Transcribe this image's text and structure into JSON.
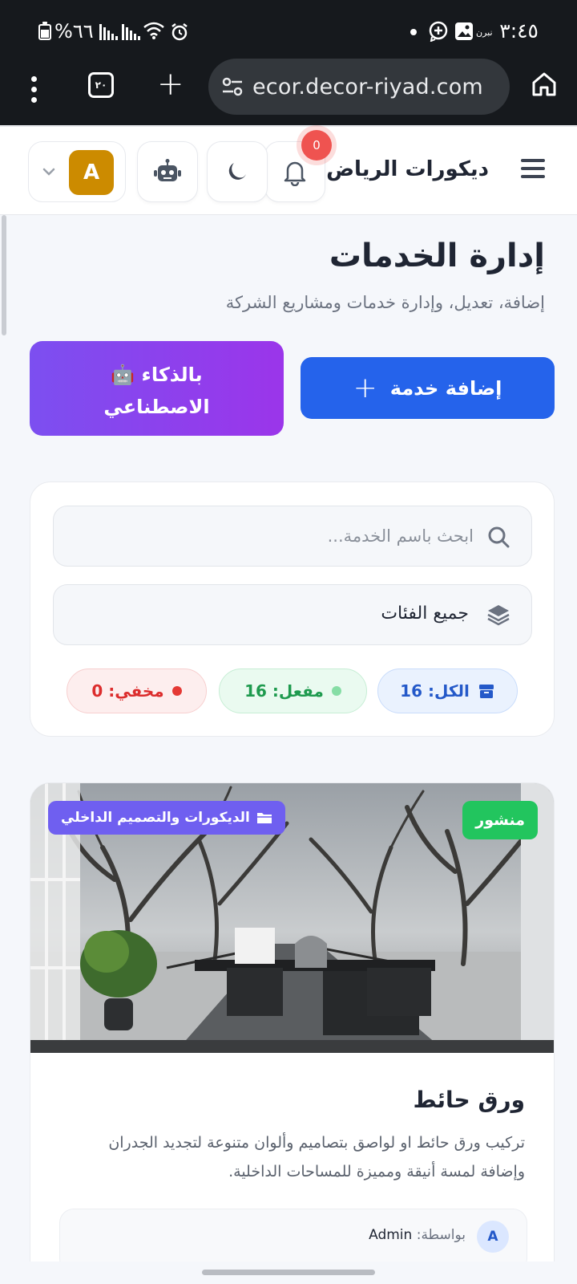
{
  "status_bar": {
    "battery_percent": "%٦٦",
    "time": "٣:٤٥",
    "carrier_small": "ﻧﺒﺮ‏ﻥ"
  },
  "browser": {
    "tab_count": "٢٠",
    "url": "ecor.decor-riyad.com"
  },
  "header": {
    "brand": "ديكورات الرياض",
    "notification_count": "0",
    "user_initial": "A"
  },
  "page": {
    "title": "إدارة الخدمات",
    "subtitle": "إضافة، تعديل، وإدارة خدمات ومشاريع الشركة",
    "add_button": "إضافة خدمة",
    "ai_button_line1": "🤖 بالذكاء",
    "ai_button_line2": "الاصطناعي"
  },
  "filters": {
    "search_placeholder": "ابحث باسم الخدمة...",
    "category_selected": "جميع الفئات",
    "stats": {
      "all_label": "الكل: 16",
      "active_label": "مفعل: 16",
      "hidden_label": "مخفي: 0"
    }
  },
  "service": {
    "status": "منشور",
    "category": "الديكورات والتصميم الداخلي",
    "title": "ورق حائط",
    "description": "تركيب ورق حائط او لواصق بتصاميم وألوان متنوعة لتجديد الجدران وإضافة لمسة أنيقة ومميزة للمساحات الداخلية.",
    "author_initial": "A",
    "author_prefix": "بواسطة:",
    "author_name": "Admin"
  },
  "colors": {
    "primary": "#2563eb",
    "ai_gradient_start": "#7c4ff0",
    "ai_gradient_end": "#9b35ea",
    "published": "#22c55e",
    "category_badge": "#6f5ff0",
    "avatar": "#cc8b00",
    "notification_badge": "#ef5350"
  },
  "icons": [
    "battery-icon",
    "signal-icon",
    "wifi-icon",
    "alarm-icon",
    "whatsapp-icon",
    "image-icon",
    "settings-sliders-icon",
    "home-icon",
    "menu-icon",
    "bell-icon",
    "moon-icon",
    "robot-icon",
    "chevron-down-icon",
    "plus-icon",
    "search-icon",
    "layers-icon",
    "box-icon",
    "folder-icon"
  ]
}
